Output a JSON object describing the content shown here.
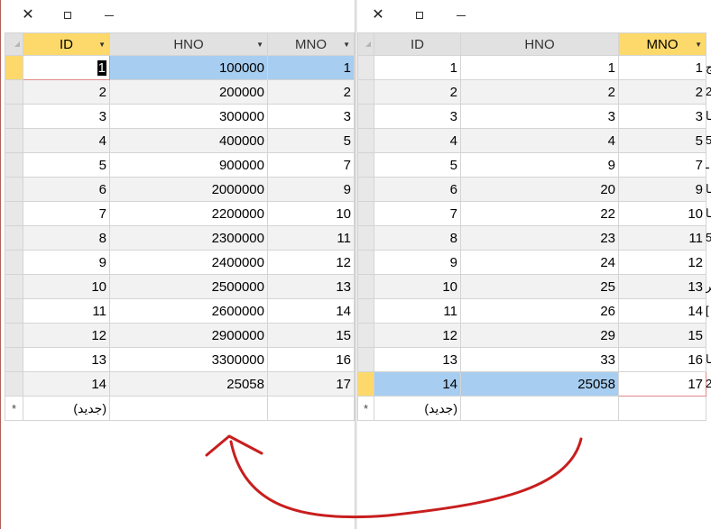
{
  "window_controls": {
    "close": "✕",
    "maximize": "□",
    "minimize": "—"
  },
  "new_record_marker": "*",
  "new_record_label": "(جديد)",
  "left_table": {
    "columns": [
      "ID",
      "HNO",
      "MNO"
    ],
    "rows": [
      [
        "1",
        "100000",
        "1"
      ],
      [
        "2",
        "200000",
        "2"
      ],
      [
        "3",
        "300000",
        "3"
      ],
      [
        "4",
        "400000",
        "5"
      ],
      [
        "5",
        "900000",
        "7"
      ],
      [
        "6",
        "2000000",
        "9"
      ],
      [
        "7",
        "2200000",
        "10"
      ],
      [
        "8",
        "2300000",
        "11"
      ],
      [
        "9",
        "2400000",
        "12"
      ],
      [
        "10",
        "2500000",
        "13"
      ],
      [
        "11",
        "2600000",
        "14"
      ],
      [
        "12",
        "2900000",
        "15"
      ],
      [
        "13",
        "3300000",
        "16"
      ],
      [
        "14",
        "25058",
        "17"
      ]
    ]
  },
  "right_table": {
    "columns": [
      "ID",
      "HNO",
      "MNO"
    ],
    "rows": [
      [
        "1",
        "1",
        "1"
      ],
      [
        "2",
        "2",
        "2"
      ],
      [
        "3",
        "3",
        "3"
      ],
      [
        "4",
        "4",
        "5"
      ],
      [
        "5",
        "9",
        "7"
      ],
      [
        "6",
        "20",
        "9"
      ],
      [
        "7",
        "22",
        "10"
      ],
      [
        "8",
        "23",
        "11"
      ],
      [
        "9",
        "24",
        "12"
      ],
      [
        "10",
        "25",
        "13"
      ],
      [
        "11",
        "26",
        "14"
      ],
      [
        "12",
        "29",
        "15"
      ],
      [
        "13",
        "33",
        "16"
      ],
      [
        "14",
        "25058",
        "17"
      ]
    ],
    "cut_off_column": [
      "ج",
      "2",
      "ـا",
      "5",
      "ـ",
      "ـا",
      "ـا",
      "5",
      "",
      "ـر",
      "[",
      "",
      "ـا",
      "2"
    ]
  },
  "colors": {
    "header": "#e1e1e1",
    "active_header": "#fcd96a",
    "highlight": "#a7cdf0",
    "annotation_arrow": "#c81e1e"
  }
}
